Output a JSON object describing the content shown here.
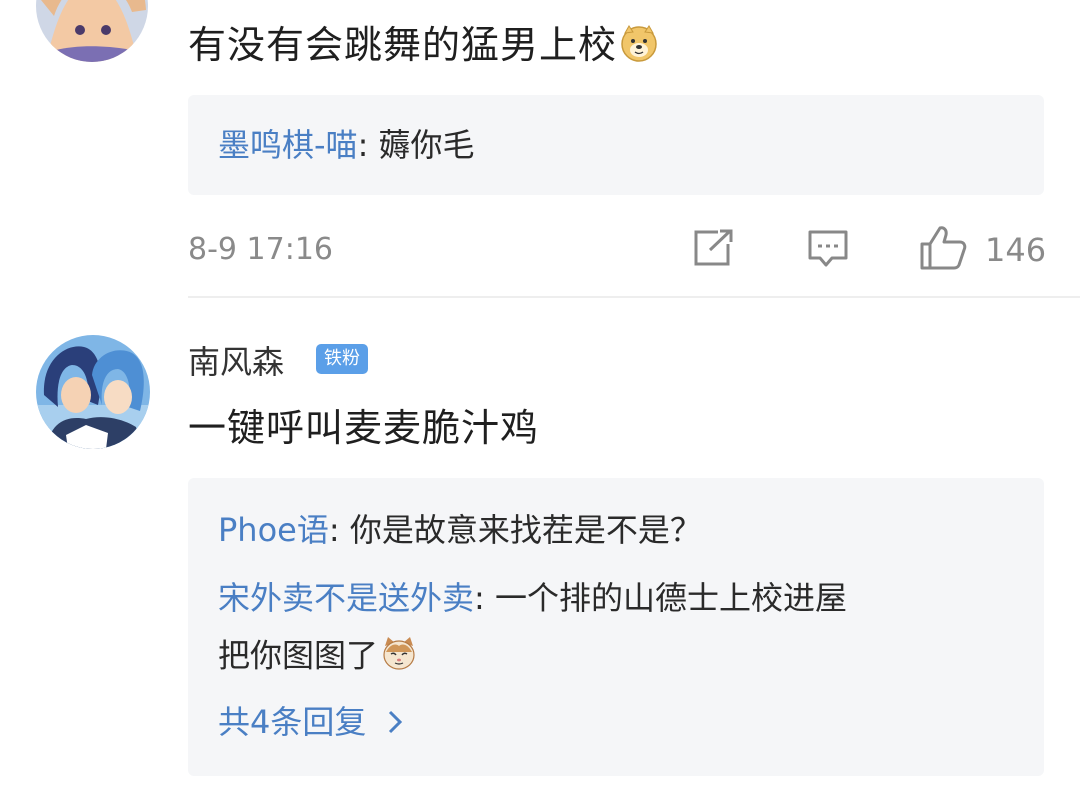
{
  "comment1": {
    "avatar_icon": "anime-girl-avatar",
    "text": "有没有会跳舞的猛男上校",
    "emoji": "doge-emoji",
    "replies": [
      {
        "user": "墨鸣棋-喵",
        "sep": ": ",
        "text": "薅你毛"
      }
    ],
    "time": "8-9 17:16",
    "actions": {
      "share_icon": "share-icon",
      "comment_icon": "comment-icon",
      "like_icon": "thumbs-up-icon"
    },
    "likes": "146"
  },
  "comment2": {
    "avatar_icon": "anime-couple-avatar",
    "username": "南风森",
    "badge": "铁粉",
    "text": "一键呼叫麦麦脆汁鸡",
    "replies": [
      {
        "user": "Phoe语",
        "sep": ": ",
        "text": "你是故意来找茬是不是？"
      },
      {
        "user": "宋外卖不是送外卖",
        "sep": ": ",
        "text": "一个排的山德士上校进屋",
        "text2": "把你图图了"
      }
    ],
    "reply_emoji": "cat-emoji",
    "more_replies": "共4条回复",
    "more_icon": "chevron-right-icon"
  },
  "colors": {
    "link_blue": "#4a7fc4",
    "badge_blue": "#5b9fe8",
    "reply_bg": "#f5f6f8",
    "meta_gray": "#8a8a8a"
  }
}
